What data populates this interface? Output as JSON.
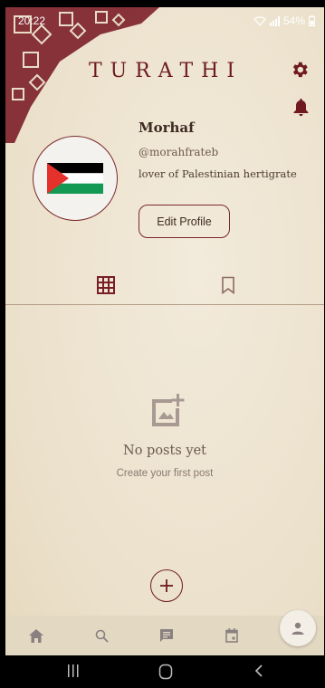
{
  "status_bar": {
    "time": "20:22",
    "battery": "54%",
    "icons": [
      "wifi-icon",
      "signal-icon",
      "battery-icon"
    ]
  },
  "header": {
    "brand": "TURATHI",
    "icons": [
      "gear-icon",
      "bell-icon"
    ]
  },
  "profile": {
    "name": "Morhaf",
    "handle": "@morahfrateb",
    "bio": "lover of Palestinian hertigrate",
    "edit_label": "Edit Profile",
    "avatar_icon": "palestine-flag-icon"
  },
  "tabs": [
    {
      "name": "posts-grid",
      "icon": "grid-icon",
      "active": true
    },
    {
      "name": "saved",
      "icon": "bookmark-icon",
      "active": false
    }
  ],
  "empty_state": {
    "title": "No posts yet",
    "subtitle": "Create your first post",
    "icon": "add-photo-icon"
  },
  "add_button_icon": "plus-icon",
  "bottom_nav": {
    "items": [
      "home-icon",
      "search-icon",
      "chat-icon",
      "calendar-icon",
      "profile-icon"
    ],
    "active": "profile-icon"
  },
  "colors": {
    "accent": "#6e1a1f",
    "background": "#ede3cf",
    "text": "#3f2b22"
  }
}
